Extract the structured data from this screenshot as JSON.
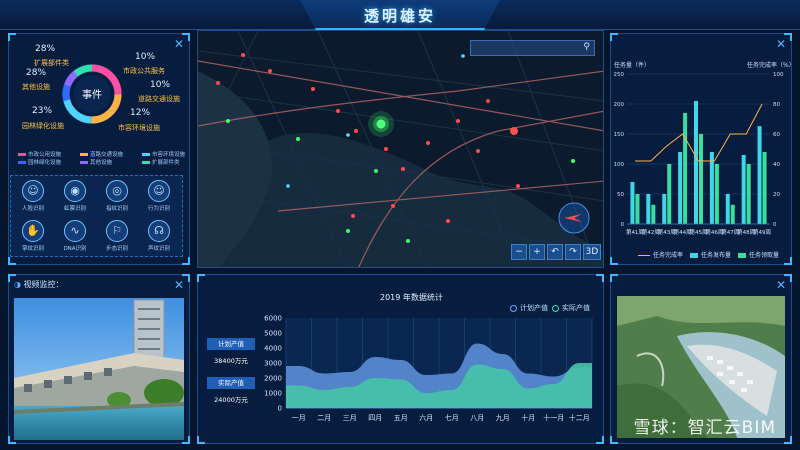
{
  "header": {
    "title": "透明雄安"
  },
  "donut": {
    "center_label": "事件",
    "items": [
      {
        "pct": "28%",
        "name": "扩展部件类"
      },
      {
        "pct": "28%",
        "name": "其他设施"
      },
      {
        "pct": "23%",
        "name": "园林绿化设施"
      },
      {
        "pct": "10%",
        "name": "市政公共服务"
      },
      {
        "pct": "10%",
        "name": "道路交通设施"
      },
      {
        "pct": "12%",
        "name": "市容环境设施"
      }
    ],
    "colors": [
      "#ff4fa3",
      "#ffb347",
      "#4fd3ff",
      "#2f6bff",
      "#8f6bff",
      "#30e0b0"
    ],
    "legend": [
      "市政公用设施",
      "道路交通设施",
      "市容环境设施",
      "园林绿化设施",
      "其他设施",
      "扩展部件类"
    ]
  },
  "icons": [
    {
      "name": "face-icon",
      "glyph": "☺",
      "label": "人脸识别"
    },
    {
      "name": "eye-icon",
      "glyph": "◉",
      "label": "虹膜识别"
    },
    {
      "name": "fingerprint-icon",
      "glyph": "◎",
      "label": "指纹识别"
    },
    {
      "name": "behavior-icon",
      "glyph": "☺",
      "label": "行为识别"
    },
    {
      "name": "palm-icon",
      "glyph": "✋",
      "label": "掌纹识别"
    },
    {
      "name": "dna-icon",
      "glyph": "∿",
      "label": "DNA识别"
    },
    {
      "name": "walk-icon",
      "glyph": "⚐",
      "label": "步态识别"
    },
    {
      "name": "voice-icon",
      "glyph": "☊",
      "label": "声纹识别"
    }
  ],
  "map": {
    "controls": [
      "−",
      "+",
      "↶",
      "↷",
      "3D"
    ]
  },
  "bar_panel": {
    "y_left_label": "任务量（件）",
    "y_right_label": "任务完成率（%）",
    "legend": [
      "任务完成率",
      "任务发布量",
      "任务领取量"
    ]
  },
  "video_panel": {
    "title": "视频监控："
  },
  "stats_panel": {
    "title": "2019 年数据统计",
    "legend": [
      "计划产值",
      "实际产值"
    ],
    "plan_label": "计划产值",
    "plan_value": "38400万元",
    "actual_label": "实际产值",
    "actual_value": "24000万元"
  },
  "watermark": "雪球：智汇云BIM",
  "chart_data": [
    {
      "type": "bar",
      "title": "",
      "categories": [
        "第41周",
        "第42周",
        "第43周",
        "第44周",
        "第45周",
        "第46周",
        "第47周",
        "第48周",
        "第49周"
      ],
      "series": [
        {
          "name": "任务发布量",
          "values": [
            70,
            50,
            50,
            120,
            205,
            120,
            50,
            115,
            163
          ]
        },
        {
          "name": "任务领取量",
          "values": [
            50,
            32,
            100,
            185,
            150,
            100,
            32,
            100,
            120
          ]
        },
        {
          "name": "任务完成率",
          "values": [
            42,
            42,
            52,
            60,
            42,
            42,
            60,
            60,
            80
          ]
        }
      ],
      "ylabel": "任务量（件）",
      "y2label": "任务完成率（%）",
      "ylim": [
        0,
        250
      ],
      "y2lim": [
        0,
        100
      ],
      "yticks": [
        0,
        50,
        100,
        150,
        200,
        250
      ],
      "y2ticks": [
        0,
        20,
        40,
        60,
        80,
        100
      ]
    },
    {
      "type": "area",
      "title": "2019 年数据统计",
      "categories": [
        "一月",
        "二月",
        "三月",
        "四月",
        "五月",
        "六月",
        "七月",
        "八月",
        "九月",
        "十月",
        "十一月",
        "十二月"
      ],
      "series": [
        {
          "name": "计划产值",
          "values": [
            2800,
            2300,
            2400,
            3400,
            3200,
            2200,
            2300,
            4300,
            3600,
            2300,
            2100,
            2700
          ]
        },
        {
          "name": "实际产值",
          "values": [
            1500,
            1200,
            1400,
            2000,
            1900,
            1000,
            1200,
            2900,
            2600,
            1300,
            1600,
            3000
          ]
        }
      ],
      "ylim": [
        0,
        6000
      ],
      "yticks": [
        0,
        1000,
        2000,
        3000,
        4000,
        5000,
        6000
      ]
    }
  ]
}
